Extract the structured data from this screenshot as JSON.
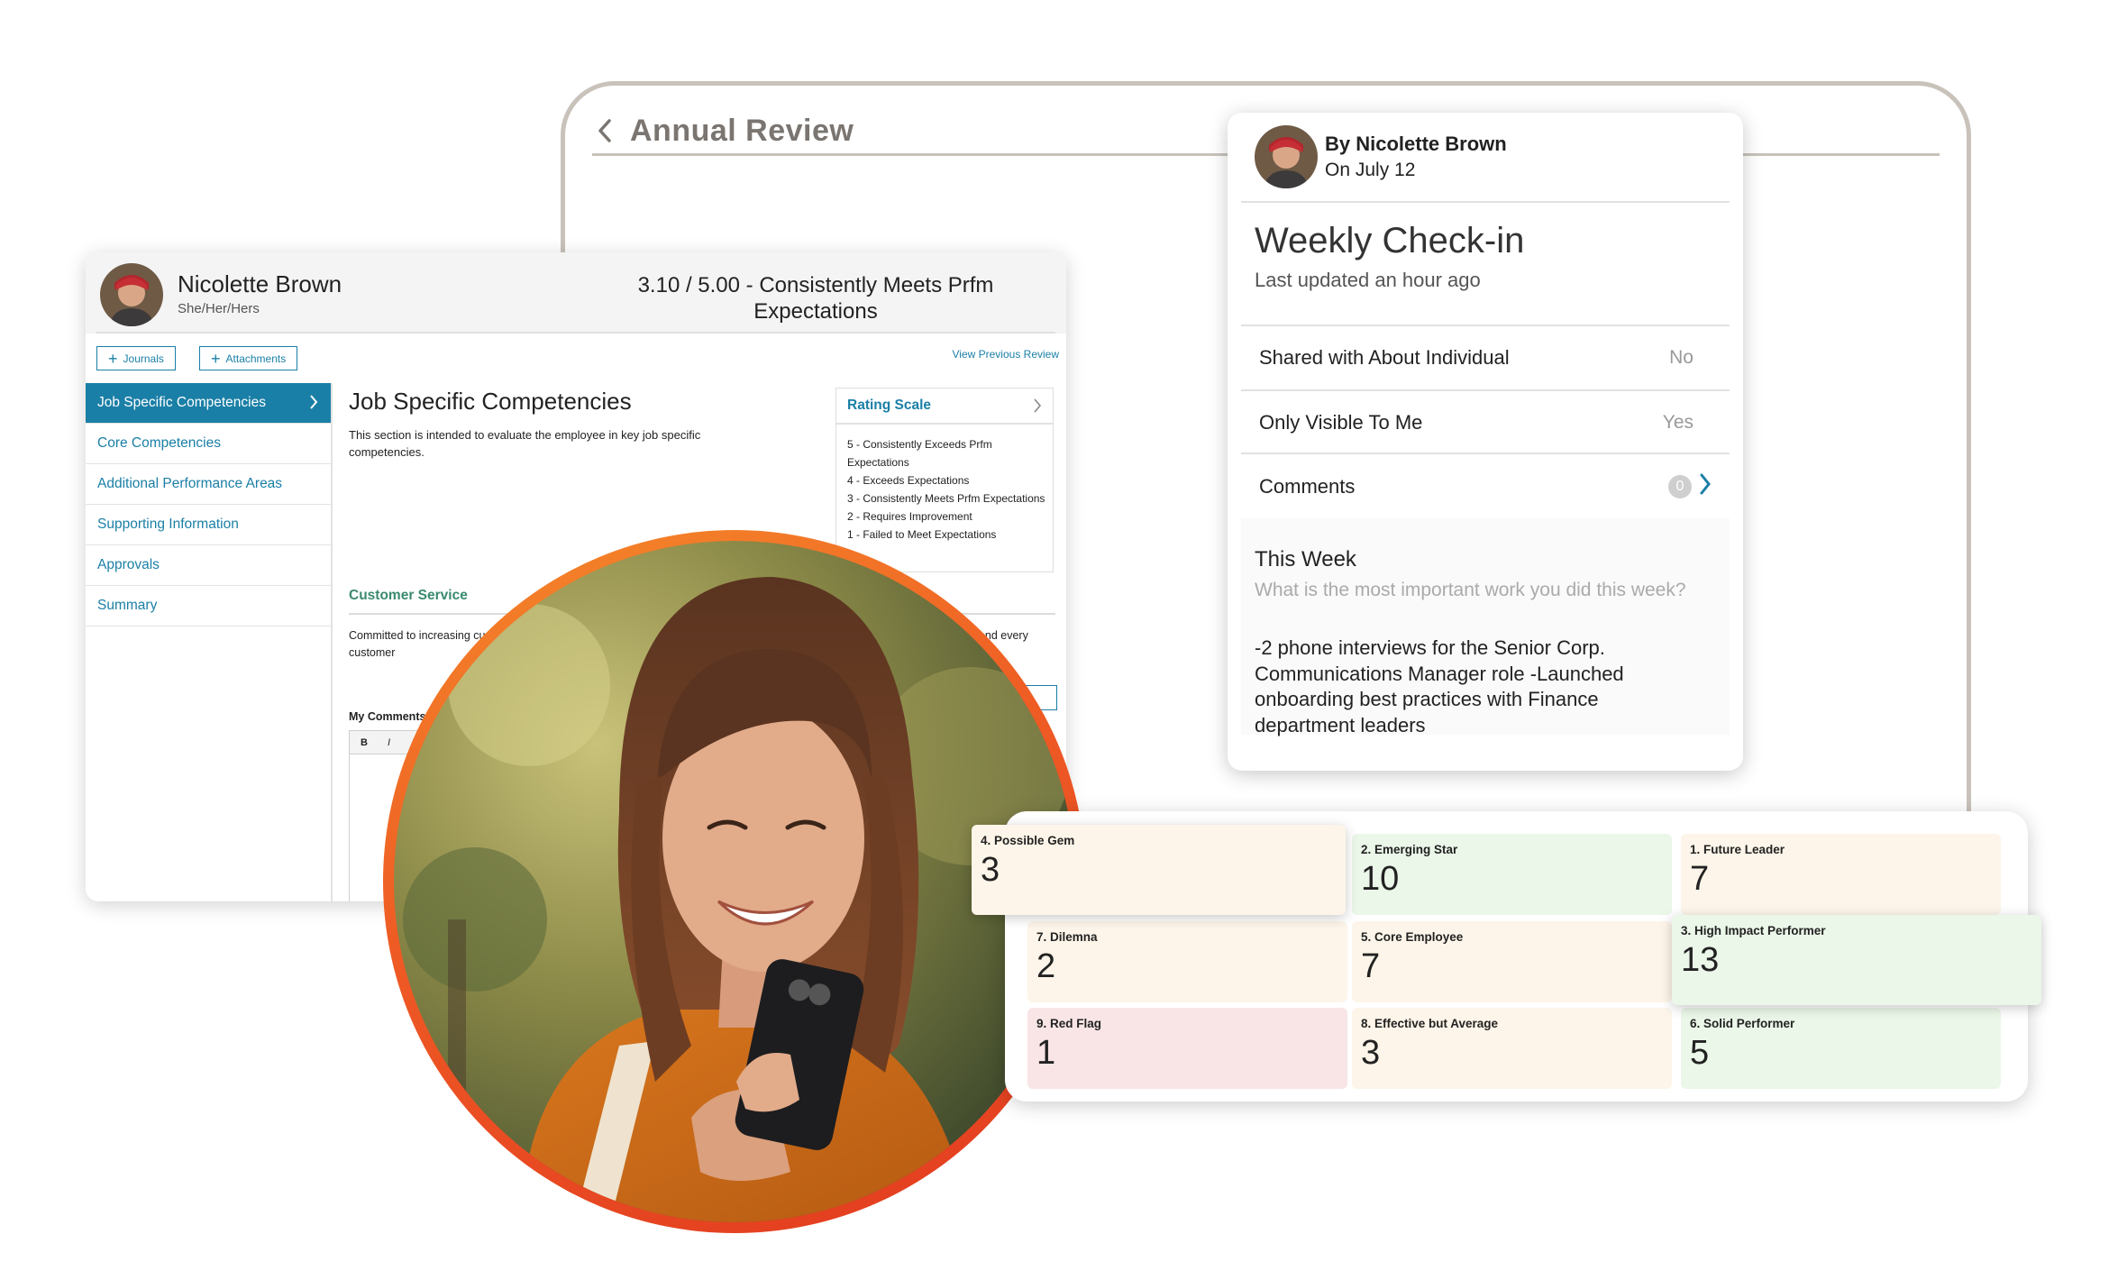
{
  "annual_review": {
    "title": "Annual Review"
  },
  "review": {
    "name": "Nicolette Brown",
    "pronouns": "She/Her/Hers",
    "score": "3.10 / 5.00 - Consistently Meets Prfm Expectations",
    "journals_label": "Journals",
    "attachments_label": "Attachments",
    "view_previous": "View Previous Review",
    "nav": [
      {
        "label": "Job Specific Competencies"
      },
      {
        "label": "Core Competencies"
      },
      {
        "label": "Additional Performance Areas"
      },
      {
        "label": "Supporting Information"
      },
      {
        "label": "Approvals"
      },
      {
        "label": "Summary"
      }
    ],
    "section_title": "Job Specific Competencies",
    "section_desc": "This section is intended to evaluate the employee in key job specific competencies.",
    "subsection_title": "Customer Service",
    "subsection_desc": "Committed to increasing customer satisfaction and resolving customer problems, ensures consistent quality of service to each and every customer",
    "my_comments": "My Comments",
    "editor_bold": "B",
    "editor_italic": "I",
    "rating_scale": {
      "title": "Rating Scale",
      "items": [
        "5 - Consistently Exceeds Prfm Expectations",
        "4 - Exceeds Expectations",
        "3 - Consistently Meets Prfm Expectations",
        "2 - Requires Improvement",
        "1 - Failed to Meet Expectations"
      ]
    }
  },
  "checkin": {
    "by": "By Nicolette Brown",
    "on": "On July 12",
    "title": "Weekly Check-in",
    "updated": "Last updated an hour ago",
    "shared_label": "Shared with About Individual",
    "shared_value": "No",
    "visible_label": "Only Visible To Me",
    "visible_value": "Yes",
    "comments_label": "Comments",
    "comments_count": "0",
    "this_week": "This Week",
    "question": "What is the most important work you did this week?",
    "answer": "-2 phone interviews for the Senior Corp. Communications Manager role -Launched onboarding best practices with Finance department leaders"
  },
  "grid": {
    "cells": [
      {
        "label": "4. Possible Gem",
        "value": "3",
        "color": "#fdf5e9"
      },
      {
        "label": "2. Emerging Star",
        "value": "10",
        "color": "#ebf7e9"
      },
      {
        "label": "1. Future Leader",
        "value": "7",
        "color": "#fdf5e9"
      },
      {
        "label": "7. Dilemna",
        "value": "2",
        "color": "#fdf5e9"
      },
      {
        "label": "5. Core Employee",
        "value": "7",
        "color": "#fdf5e9"
      },
      {
        "label": "3. High Impact Performer",
        "value": "13",
        "color": "#ebf7e9"
      },
      {
        "label": "9. Red Flag",
        "value": "1",
        "color": "#f9e5e6"
      },
      {
        "label": "8. Effective but Average",
        "value": "3",
        "color": "#fdf5e9"
      },
      {
        "label": "6. Solid Performer",
        "value": "5",
        "color": "#ebf7e9"
      }
    ]
  },
  "colors": {
    "accent": "#1a7fa6",
    "ring": "#ee5a24",
    "section_green": "#3a8a6e"
  }
}
